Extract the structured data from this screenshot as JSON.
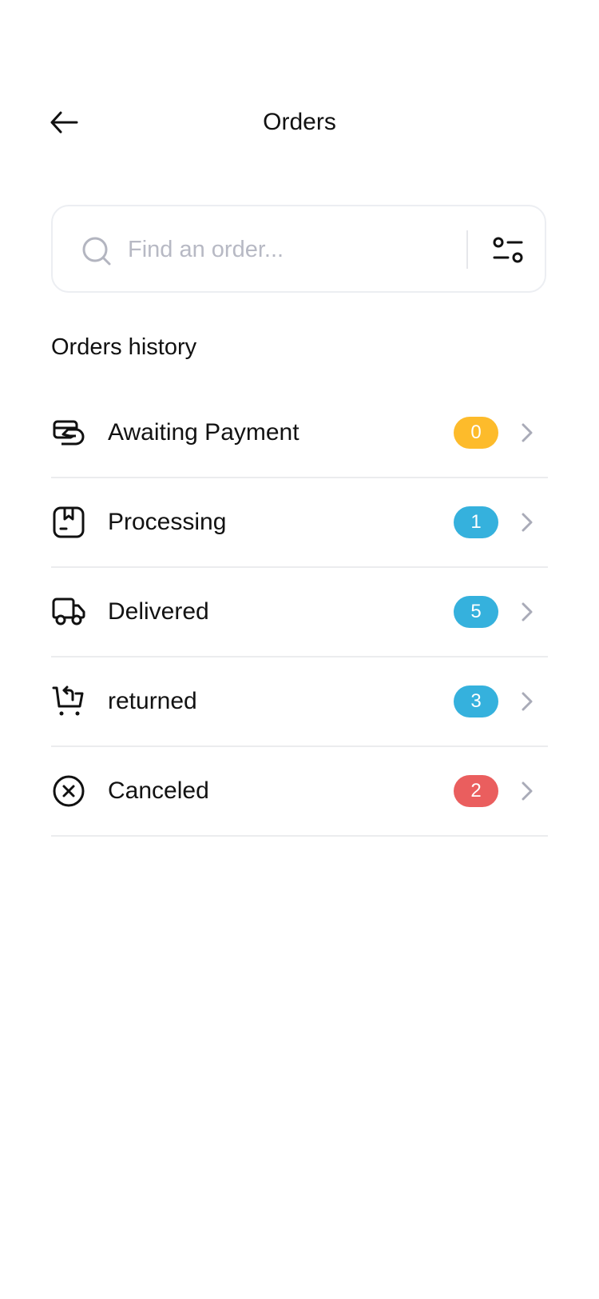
{
  "header": {
    "title": "Orders",
    "back_icon": "arrow-left-icon"
  },
  "search": {
    "placeholder": "Find an order...",
    "value": "",
    "icon": "search-icon",
    "filter_icon": "filter-sliders-icon"
  },
  "section": {
    "title": "Orders history"
  },
  "orders": [
    {
      "label": "Awaiting Payment",
      "count": "0",
      "icon": "payment-card-icon",
      "badge_color": "#FDBB2B"
    },
    {
      "label": "Processing",
      "count": "1",
      "icon": "package-box-icon",
      "badge_color": "#35B1DD"
    },
    {
      "label": "Delivered",
      "count": "5",
      "icon": "delivery-truck-icon",
      "badge_color": "#35B1DD"
    },
    {
      "label": "returned",
      "count": "3",
      "icon": "cart-return-icon",
      "badge_color": "#35B1DD"
    },
    {
      "label": "Canceled",
      "count": "2",
      "icon": "cancel-circle-icon",
      "badge_color": "#EA5E5E"
    }
  ],
  "colors": {
    "chevron": "#A9ABB8",
    "divider": "#EBECEE"
  }
}
